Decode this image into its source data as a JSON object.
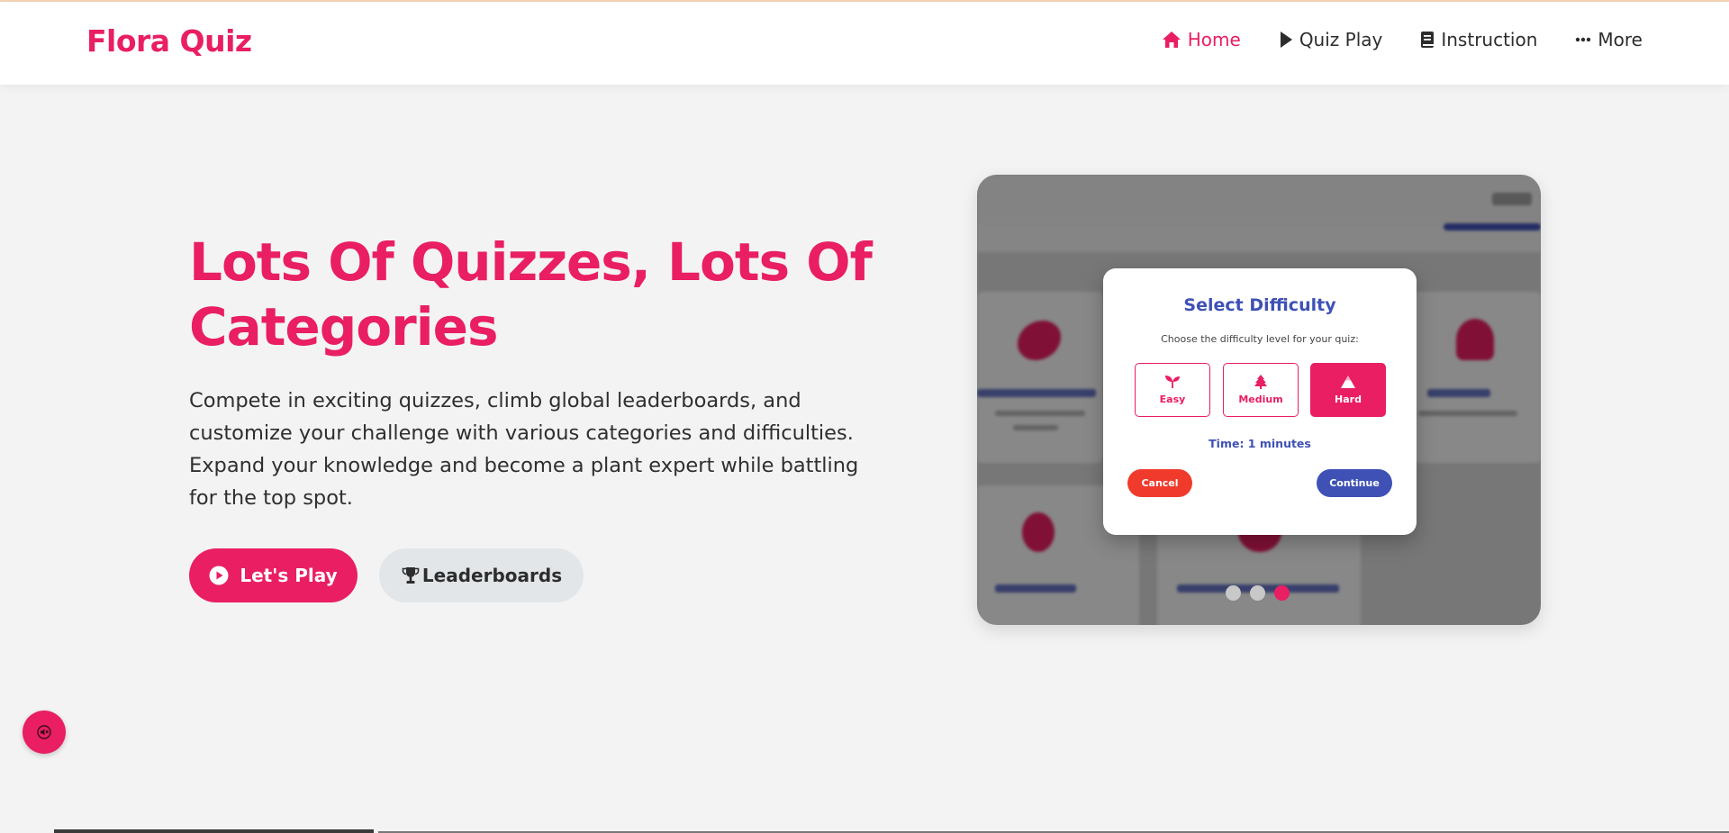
{
  "brand": {
    "name": "Flora Quiz"
  },
  "nav": {
    "items": [
      {
        "label": "Home",
        "icon": "home-icon",
        "active": true
      },
      {
        "label": "Quiz Play",
        "icon": "play-icon"
      },
      {
        "label": "Instruction",
        "icon": "book-icon"
      },
      {
        "label": "More",
        "icon": "more-dots-icon"
      }
    ]
  },
  "hero": {
    "title": "Lots Of Quizzes, Lots Of Categories",
    "description": "Compete in exciting quizzes, climb global leaderboards, and customize your challenge with various categories and difficulties. Expand your knowledge and become a plant expert while battling for the top spot.",
    "play_label": "Let's Play",
    "leaderboards_label": "Leaderboards"
  },
  "modal": {
    "title": "Select Difficulty",
    "subtitle": "Choose the difficulty level for your quiz:",
    "options": [
      {
        "label": "Easy",
        "icon": "sprout-icon"
      },
      {
        "label": "Medium",
        "icon": "tree-icon"
      },
      {
        "label": "Hard",
        "icon": "mountain-icon",
        "selected": true
      }
    ],
    "time": "Time: 1 minutes",
    "cancel_label": "Cancel",
    "continue_label": "Continue"
  },
  "carousel": {
    "slides": 3,
    "active_index": 2
  },
  "colors": {
    "primary": "#e91e63",
    "secondary": "#3f51b5",
    "cancel": "#f03b2c",
    "background": "#f3f3f3"
  }
}
